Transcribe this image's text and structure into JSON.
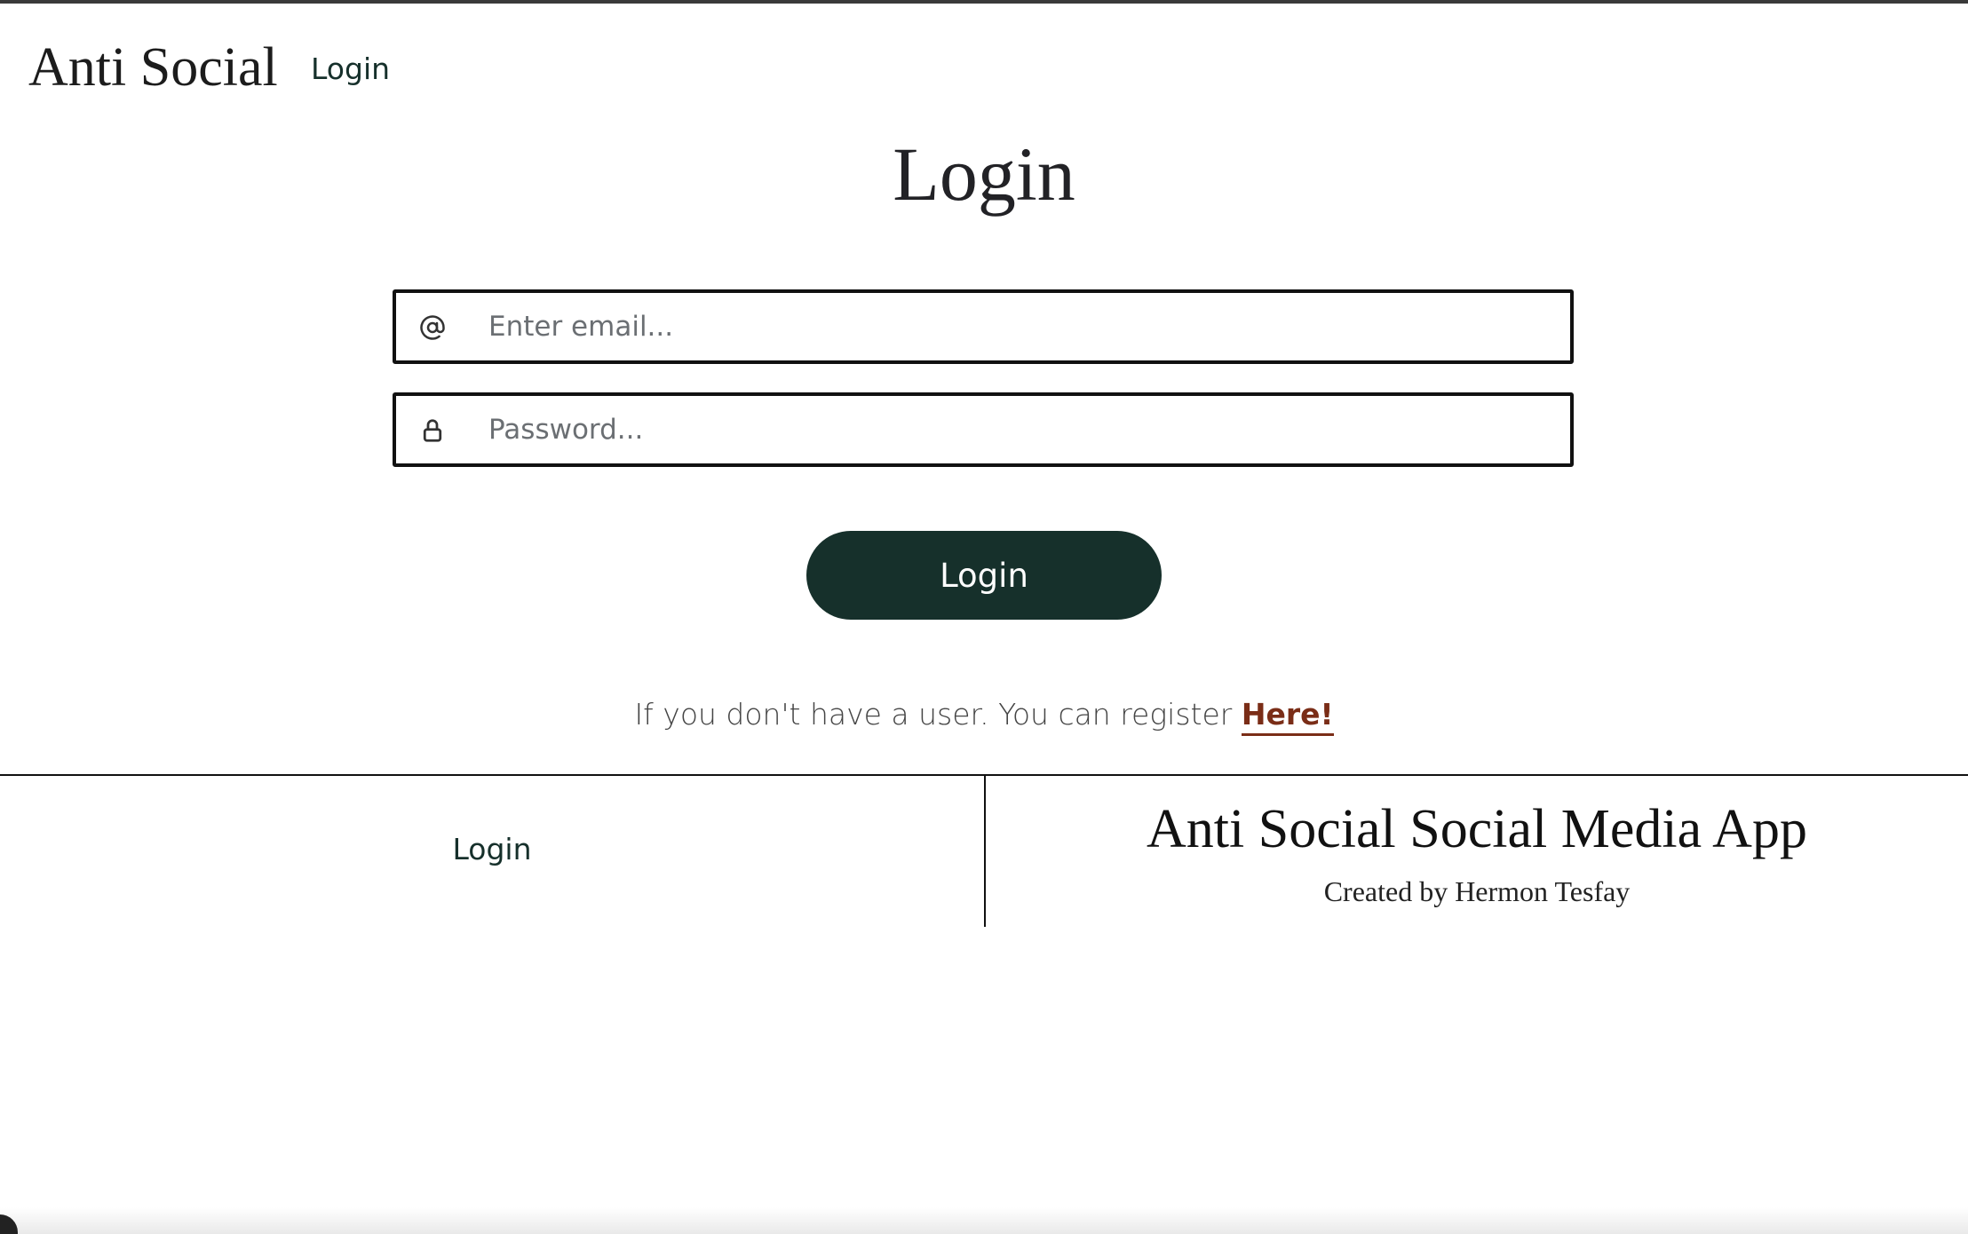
{
  "nav": {
    "brand": "Anti Social",
    "login_link": "Login"
  },
  "page": {
    "title": "Login"
  },
  "form": {
    "email": {
      "placeholder": "Enter email...",
      "value": "",
      "icon": "at-sign-icon"
    },
    "password": {
      "placeholder": "Password...",
      "value": "",
      "icon": "lock-icon"
    },
    "submit_label": "Login"
  },
  "register": {
    "text": "If you don't have a user. You can register ",
    "link_label": "Here!"
  },
  "footer": {
    "login_link": "Login",
    "title": "Anti Social Social Media App",
    "credit": "Created by Hermon Tesfay"
  },
  "colors": {
    "primary": "#16302b",
    "link_accent": "#7a2d17",
    "border": "#111111"
  }
}
